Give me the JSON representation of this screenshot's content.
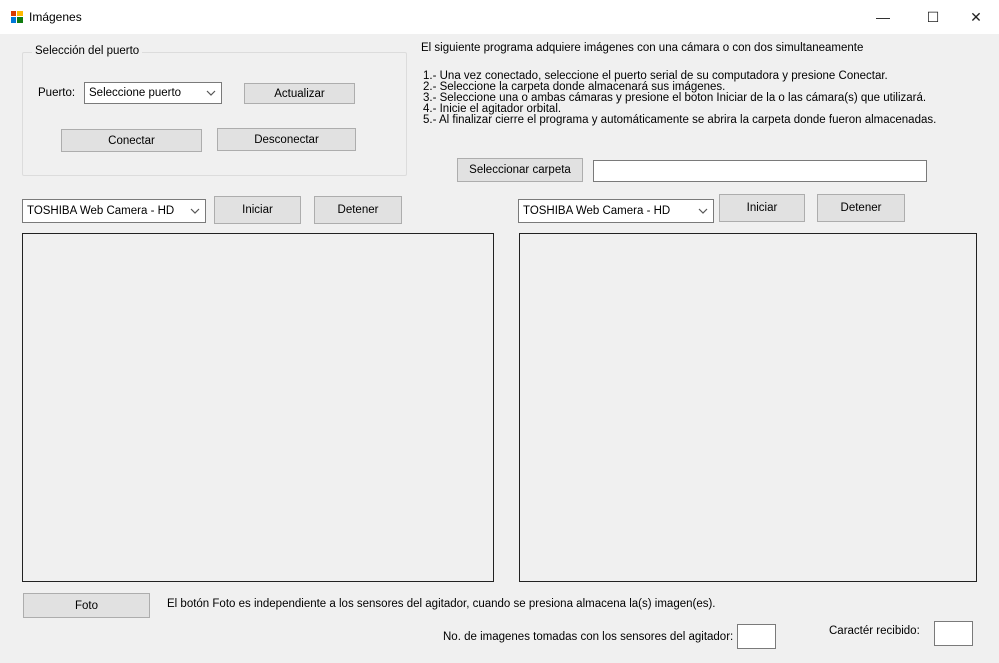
{
  "window": {
    "title": "Imágenes",
    "minimize_glyph": "—",
    "maximize_glyph": "☐",
    "close_glyph": "✕",
    "icon": "app-window-icon"
  },
  "port_group": {
    "legend": "Selección del puerto",
    "port_label": "Puerto:",
    "port_select_value": "Seleccione puerto",
    "refresh_label": "Actualizar",
    "connect_label": "Conectar",
    "disconnect_label": "Desconectar"
  },
  "instructions": {
    "heading": "El siguiente programa adquiere imágenes con una cámara o con dos simultaneamente",
    "steps": [
      "1.- Una vez conectado, seleccione el puerto serial de su computadora y presione Conectar.",
      "2.- Seleccione la carpeta donde almacenará sus imágenes.",
      "3.- Seleccione una o ambas cámaras y presione el boton Iniciar de la o las cámara(s) que utilizará.",
      "4.- Inicie el agitador orbital.",
      "5.- Al finalizar cierre el programa y automáticamente se abrira la carpeta donde fueron almacenadas."
    ]
  },
  "folder": {
    "button_label": "Seleccionar carpeta",
    "path_value": ""
  },
  "camera_left": {
    "select_value": "TOSHIBA Web Camera - HD",
    "start_label": "Iniciar",
    "stop_label": "Detener"
  },
  "camera_right": {
    "select_value": "TOSHIBA Web Camera - HD",
    "start_label": "Iniciar",
    "stop_label": "Detener"
  },
  "footer": {
    "photo_label": "Foto",
    "photo_note": "El botón Foto es independiente a los sensores del agitador, cuando se presiona almacena la(s) imagen(es).",
    "count_label": "No. de imagenes tomadas con los sensores del agitador:",
    "count_value": "",
    "char_label": "Caractér recibido:",
    "char_value": ""
  }
}
